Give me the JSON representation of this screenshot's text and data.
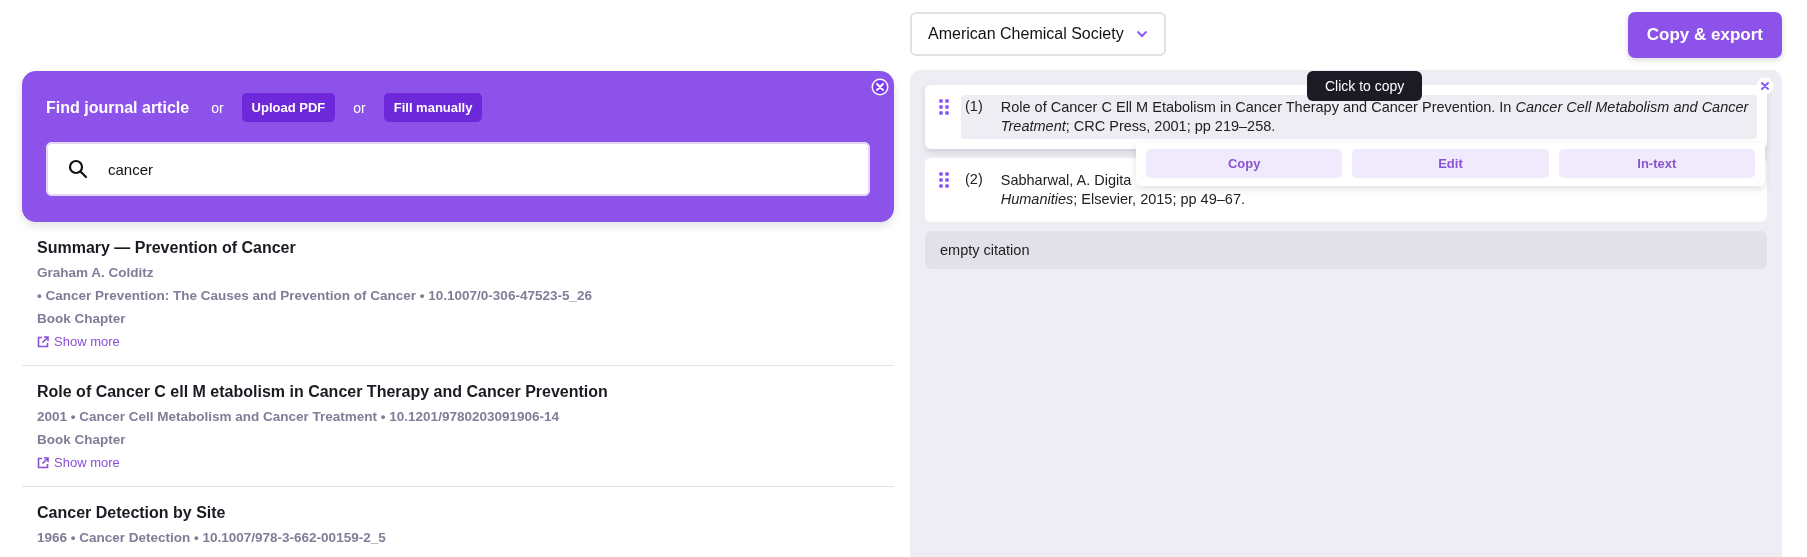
{
  "search_card": {
    "title": "Find journal article",
    "separators": [
      "or",
      "or"
    ],
    "buttons": [
      "Upload PDF",
      "Fill manually"
    ],
    "search": {
      "value": "cancer"
    }
  },
  "results": [
    {
      "title": "Summary — Prevention of Cancer",
      "meta": [
        "Graham A. Colditz",
        "• Cancer Prevention: The Causes and Prevention of Cancer • 10.1007/0-306-47523-5_26",
        "Book Chapter"
      ],
      "link": "Show more"
    },
    {
      "title": "Role of Cancer C ell M etabolism in Cancer Therapy and Cancer Prevention",
      "meta": [
        "2001 • Cancer Cell Metabolism and Cancer Treatment • 10.1201/9780203091906-14",
        "Book Chapter"
      ],
      "link": "Show more"
    },
    {
      "title": "Cancer Detection by Site",
      "meta": [
        "1966 • Cancer Detection • 10.1007/978-3-662-00159-2_5"
      ]
    }
  ],
  "style_select": {
    "value": "American Chemical Society"
  },
  "export_button": "Copy & export",
  "citations": [
    {
      "number": "(1)",
      "lines": [
        "Role of Cancer C Ell M Etabolism in Cancer Therapy and Cancer Prevention. In *Cancer Cell Metabolism and Cancer*",
        "*Treatment*; CRC Press, 2001; pp 219–258."
      ],
      "highlighted": true
    },
    {
      "number": "(2)",
      "lines": [
        "Sabharwal, A. Digita",
        "*Humanities*; Elsevier, 2015; pp 49–67."
      ],
      "highlighted": false
    }
  ],
  "empty_citation": "empty citation",
  "tooltip": "Click to copy",
  "citation_actions": [
    "Copy",
    "Edit",
    "In-text"
  ]
}
